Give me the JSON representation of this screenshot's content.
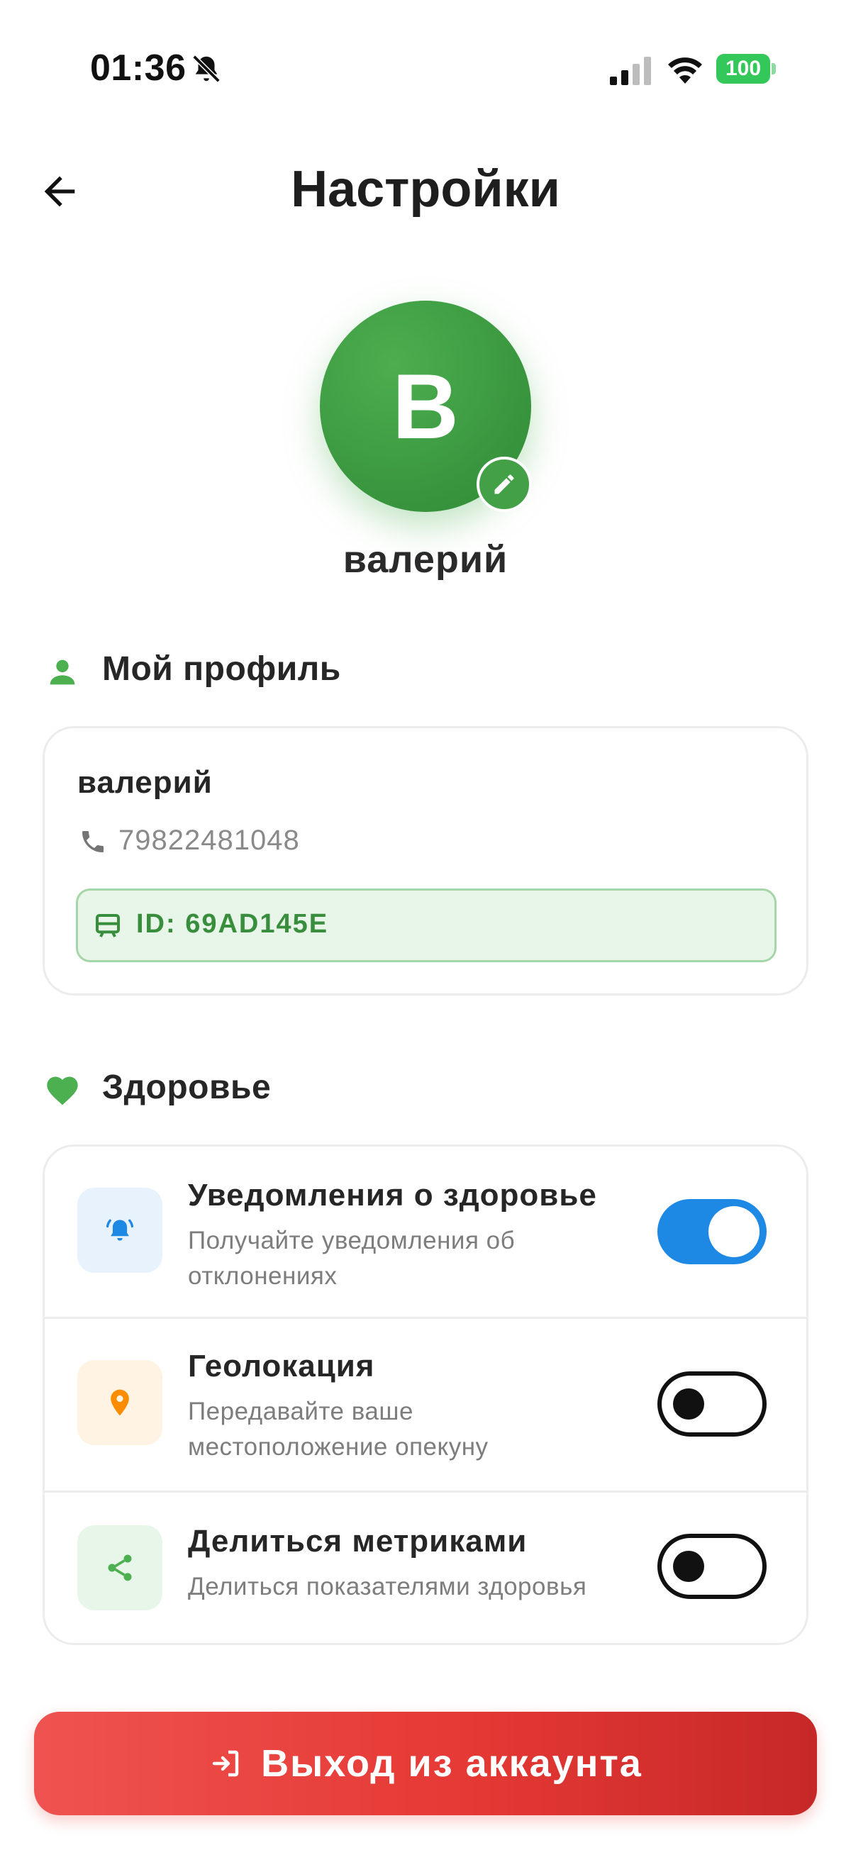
{
  "status_bar": {
    "time": "01:36",
    "battery": "100",
    "icons": [
      "bell-slash-icon",
      "cellular-signal-icon",
      "wifi-icon",
      "battery-icon"
    ]
  },
  "header": {
    "title": "Настройки",
    "back_icon": "arrow-left-icon"
  },
  "avatar": {
    "initial": "В",
    "name": "валерий",
    "edit_icon": "pencil-icon",
    "color": "#43a047"
  },
  "profile_section": {
    "title": "Мой профиль",
    "icon": "person-icon",
    "card": {
      "name": "валерий",
      "phone": "79822481048",
      "phone_icon": "phone-icon",
      "id_label": "ID: 69AD145E",
      "id_icon": "badge-icon"
    }
  },
  "health_section": {
    "title": "Здоровье",
    "icon": "heart-icon",
    "items": [
      {
        "title": "Уведомления о здоровье",
        "subtitle_line1": "Получайте уведомления об",
        "subtitle_line2": "отклонениях",
        "icon": "bell-ring-icon",
        "enabled": true
      },
      {
        "title": "Геолокация",
        "subtitle_line1": "Передавайте ваше",
        "subtitle_line2": "местоположение опекуну",
        "icon": "location-pin-icon",
        "enabled": false
      },
      {
        "title": "Делиться метриками",
        "subtitle_line1": "Делиться показателями здоровья",
        "icon": "share-icon",
        "enabled": false
      }
    ]
  },
  "logout": {
    "label": "Выход из аккаунта",
    "icon": "logout-icon",
    "color": "#e53935"
  }
}
